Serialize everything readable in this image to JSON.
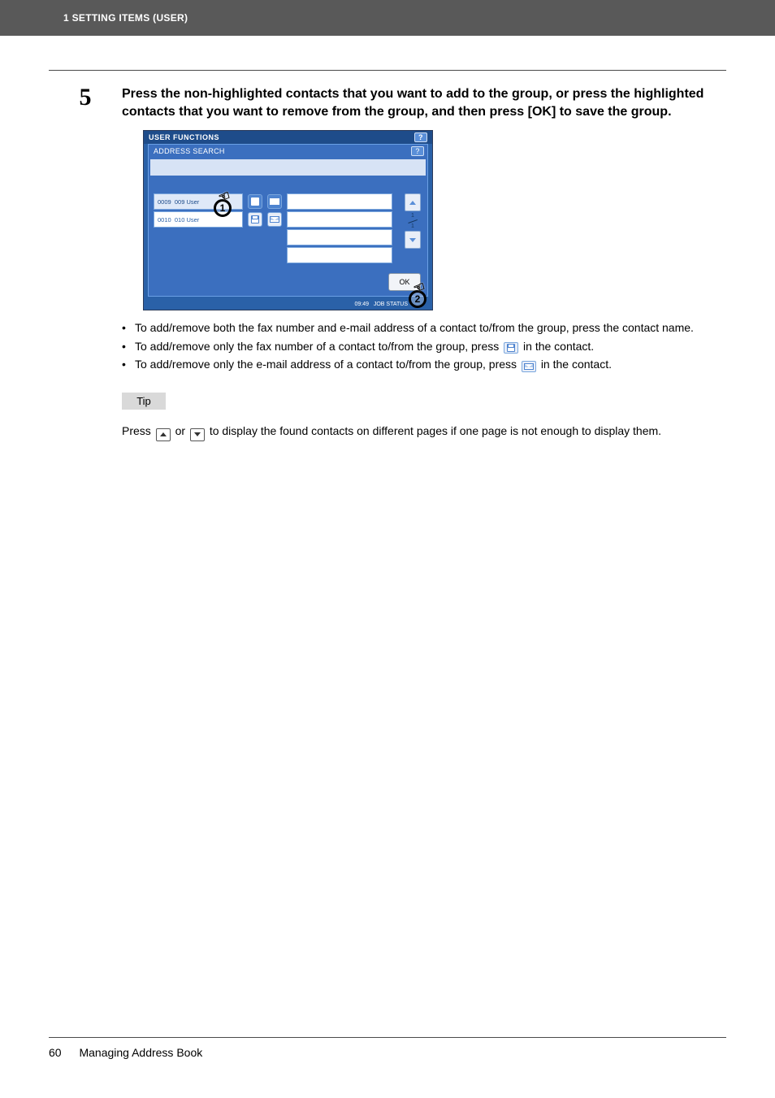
{
  "header": {
    "title": "1 SETTING ITEMS (USER)"
  },
  "step": {
    "number": "5",
    "instruction": "Press the non-highlighted contacts that you want to add to the group, or press the highlighted contacts that you want to remove from the group, and then press [OK] to save the group."
  },
  "screenshot": {
    "window_title": "USER FUNCTIONS",
    "panel_title": "ADDRESS SEARCH",
    "help_label": "?",
    "rows": [
      {
        "id": "0009",
        "name": "009 User",
        "highlighted": true
      },
      {
        "id": "0010",
        "name": "010 User",
        "highlighted": false
      }
    ],
    "pager": {
      "current": "1",
      "total": "1"
    },
    "ok_label": "OK",
    "time": "09:49",
    "job_status": "JOB STATUS"
  },
  "callouts": {
    "one": "1",
    "two": "2"
  },
  "bullets": {
    "b1_pre": "To add/remove both the fax number and e-mail address of a contact to/from the group, press the contact name.",
    "b2_pre": "To add/remove only the fax number of a contact to/from the group, press ",
    "b2_post": " in the contact.",
    "b3_pre": "To add/remove only the e-mail address of a contact to/from the group, press ",
    "b3_post": " in the contact."
  },
  "tip": {
    "label": "Tip",
    "text_pre": "Press ",
    "text_mid": " or ",
    "text_post": " to display the found contacts on different pages if one page is not enough to display them."
  },
  "footer": {
    "page": "60",
    "section": "Managing Address Book"
  }
}
